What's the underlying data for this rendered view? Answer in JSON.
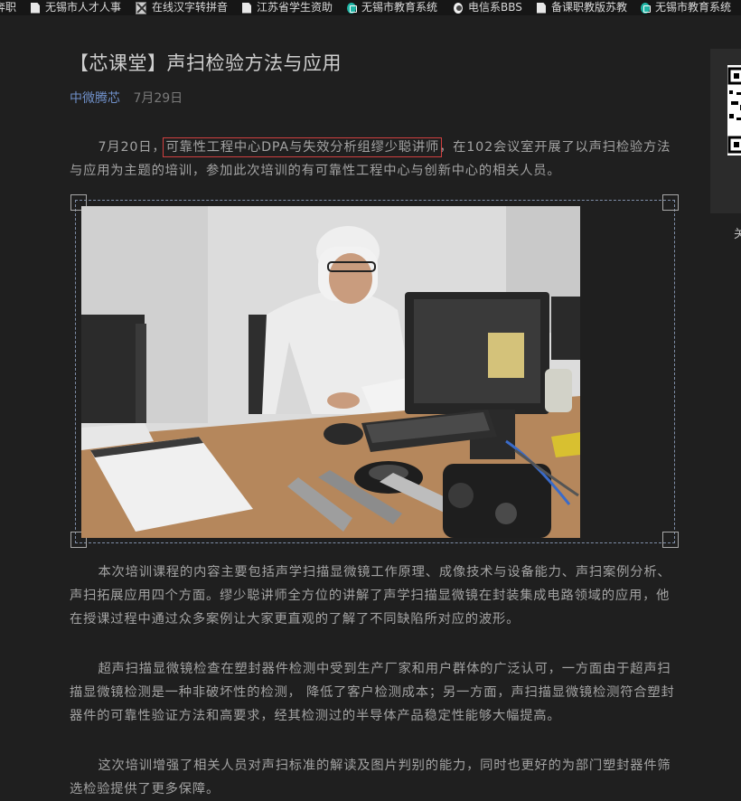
{
  "bookmarks": [
    {
      "label": "奔职",
      "icon": "page-icon"
    },
    {
      "label": "无锡市人才人事",
      "icon": "page-icon"
    },
    {
      "label": "在线汉字转拼音",
      "icon": "pinyin-tool-icon"
    },
    {
      "label": "江苏省学生资助",
      "icon": "page-icon"
    },
    {
      "label": "无锡市教育系统",
      "icon": "education-site-icon"
    },
    {
      "label": "电信系BBS",
      "icon": "bbs-icon"
    },
    {
      "label": "备课职教版苏教",
      "icon": "page-icon"
    },
    {
      "label": "无锡市教育系统",
      "icon": "education-site-icon"
    }
  ],
  "article": {
    "title": "【芯课堂】声扫检验方法与应用",
    "author": "中微腾芯",
    "date": "7月29日",
    "p1_prefix": "7月20日，",
    "p1_highlight": "可靠性工程中心DPA与失效分析组缪少聪讲师",
    "p1_suffix": "，在102会议室开展了以声扫检验方法与应用为主题的培训，参加此次培训的有可靠性工程中心与创新中心的相关人员。",
    "p2": "本次培训课程的内容主要包括声学扫描显微镜工作原理、成像技术与设备能力、声扫案例分析、声扫拓展应用四个方面。缪少聪讲师全方位的讲解了声学扫描显微镜在封装集成电路领域的应用，他在授课过程中通过众多案例让大家更直观的了解了不同缺陷所对应的波形。",
    "p3": "超声扫描显微镜检查在塑封器件检测中受到生产厂家和用户群体的广泛认可，一方面由于超声扫描显微镜检测是一种非破坏性的检测， 降低了客户检测成本；另一方面，声扫描显微镜检测符合塑封器件的可靠性验证方法和高要求，经其检测过的半导体产品稳定性能够大幅提高。",
    "p4": "这次培训增强了相关人员对声扫标准的解读及图片判别的能力，同时也更好的为部门塑封器件筛选检验提供了更多保障。"
  },
  "side_panel": {
    "label": "关"
  }
}
